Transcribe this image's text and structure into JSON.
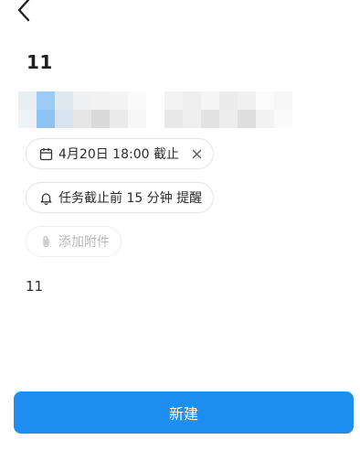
{
  "header": {
    "back_icon": "chevron-left-icon"
  },
  "task": {
    "title": "11",
    "note": "11"
  },
  "chips": {
    "due": {
      "icon": "calendar-icon",
      "label": "4月20日 18:00 截止",
      "close_icon": "close-icon"
    },
    "reminder": {
      "icon": "bell-icon",
      "label": "任务截止前 15 分钟 提醒"
    },
    "attachment": {
      "icon": "paperclip-icon",
      "label": "添加附件"
    }
  },
  "actions": {
    "create_label": "新建"
  },
  "colors": {
    "primary": "#1f8ef1",
    "chip_border": "#e3e3e3",
    "disabled_text": "#b9b9b9"
  }
}
